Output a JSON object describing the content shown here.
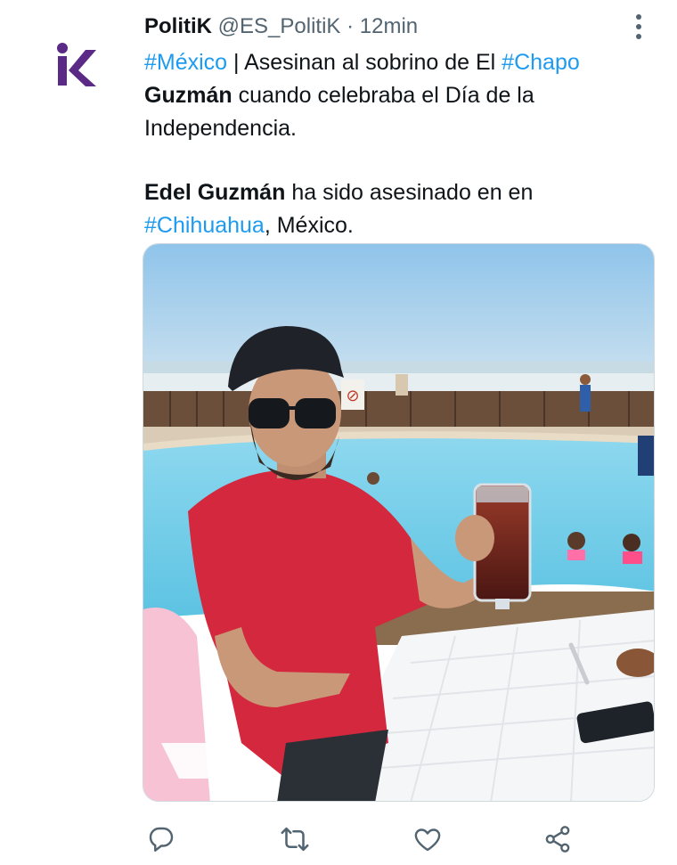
{
  "tweet": {
    "display_name": "PolitiK",
    "handle": "@ES_PolitiK",
    "separator": "·",
    "time": "12min",
    "logo_letters": "iK",
    "text_segments": [
      {
        "text": "#México",
        "style": "hashtag"
      },
      {
        "text": " | Asesinan al sobrino de El ",
        "style": "plain"
      },
      {
        "text": "#Chapo",
        "style": "hashtag"
      },
      {
        "text": " ",
        "style": "plain"
      },
      {
        "text": "Guzmán",
        "style": "bold"
      },
      {
        "text": " cuando celebraba el Día de la Independencia.",
        "style": "plain"
      }
    ],
    "text_segments_2": [
      {
        "text": "Edel Guzmán",
        "style": "bold"
      },
      {
        "text": " ha sido asesinado en en ",
        "style": "plain"
      },
      {
        "text": "#Chihuahua",
        "style": "hashtag"
      },
      {
        "text": ", México.",
        "style": "plain"
      }
    ],
    "media": {
      "type": "photo",
      "sign_text": "⊘"
    }
  },
  "actions": {
    "reply_icon": "reply-icon",
    "retweet_icon": "retweet-icon",
    "like_icon": "heart-icon",
    "share_icon": "share-icon"
  },
  "colors": {
    "accent": "#1d9bf0",
    "text": "#0f1419",
    "muted": "#536471",
    "brand": "#5b2a86"
  }
}
